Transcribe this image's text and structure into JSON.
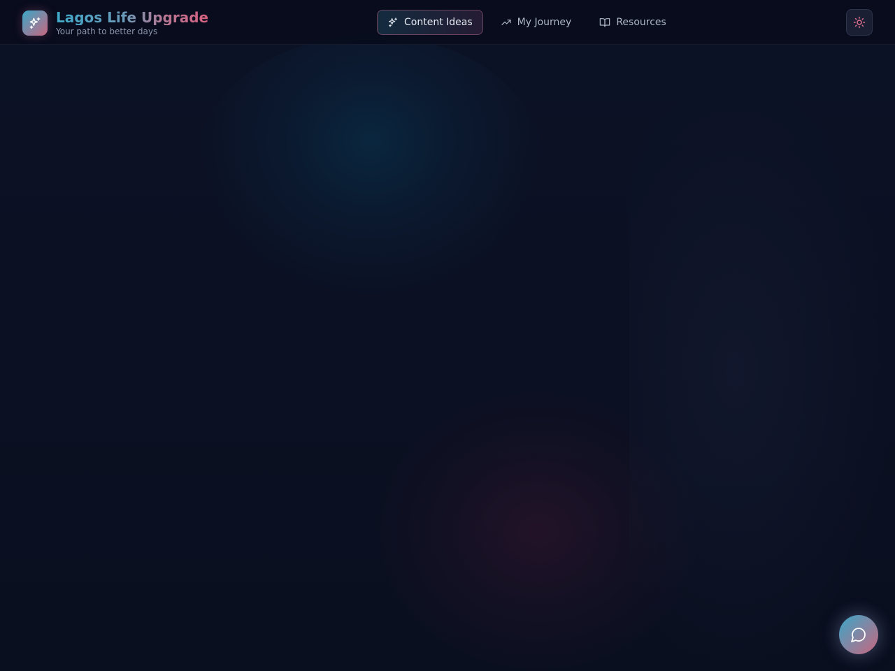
{
  "header": {
    "brand": {
      "title": "Lagos Life Upgrade",
      "subtitle": "Your path to better days",
      "logo_icon": "sparkles-icon"
    },
    "nav": [
      {
        "label": "Content Ideas",
        "icon": "sparkles-icon",
        "active": true
      },
      {
        "label": "My Journey",
        "icon": "trending-up-icon",
        "active": false
      },
      {
        "label": "Resources",
        "icon": "book-open-icon",
        "active": false
      }
    ],
    "theme_toggle": {
      "icon": "sun-icon"
    }
  },
  "chat": {
    "icon": "message-circle-icon"
  },
  "colors": {
    "accent_teal": "#3ba7c8",
    "accent_pink": "#c8667f",
    "background": "#0b1023"
  }
}
